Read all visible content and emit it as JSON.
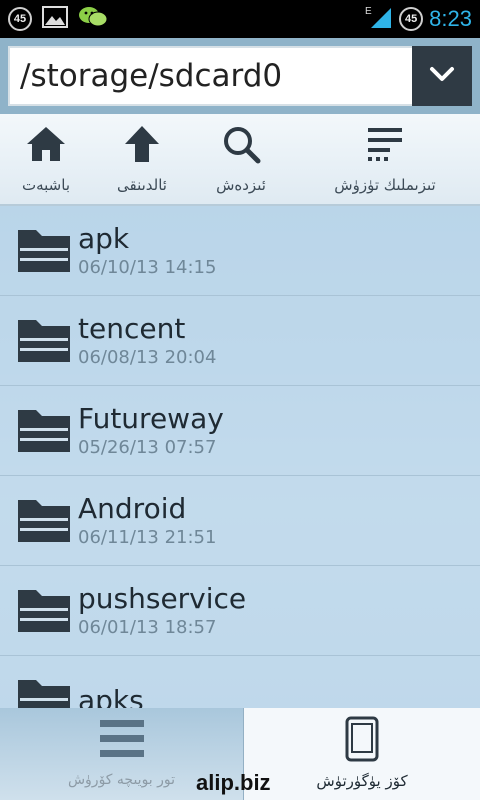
{
  "status_bar": {
    "badge_left": "45",
    "badge_right": "45",
    "network": "E",
    "clock": "8:23",
    "clock_color": "#2fb4e8"
  },
  "path_bar": {
    "path": "/storage/sdcard0"
  },
  "toolbar": {
    "home_label": "باشبەت",
    "up_label": "ئالدىنقى",
    "search_label": "ئىزدەش",
    "sort_label": "تىزىملىك تۈزۈش"
  },
  "files": [
    {
      "name": "apk",
      "date": "06/10/13 14:15"
    },
    {
      "name": "tencent",
      "date": "06/08/13 20:04"
    },
    {
      "name": "Futureway",
      "date": "05/26/13 07:57"
    },
    {
      "name": "Android",
      "date": "06/11/13 21:51"
    },
    {
      "name": "pushservice",
      "date": "06/01/13 18:57"
    },
    {
      "name": "apks",
      "date": ""
    }
  ],
  "bottom_bar": {
    "left_label": "تور بويىچە كۆرۈش",
    "right_label": "كۆز يۈگۈرتۈش"
  },
  "watermark": "alip.biz",
  "colors": {
    "dark": "#2f3a44",
    "accent": "#2fb4e8"
  }
}
